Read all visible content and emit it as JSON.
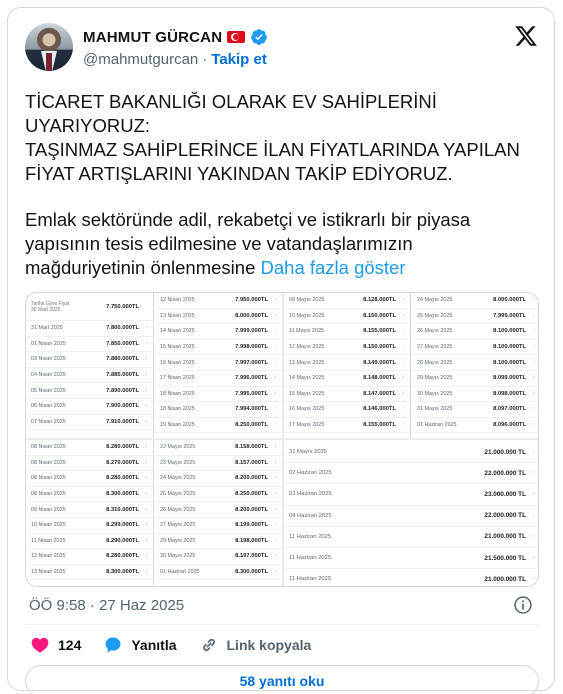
{
  "author": {
    "display_name": "MAHMUT GÜRCAN",
    "handle": "@mahmutgurcan",
    "separator": "·",
    "follow_label": "Takip et"
  },
  "tweet": {
    "paragraph1": "TİCARET BAKANLIĞI OLARAK EV SAHİPLERİNİ UYARIYORUZ:",
    "paragraph2": "TAŞINMAZ SAHİPLERİNCE İLAN FİYATLARINDA YAPILAN FİYAT ARTIŞLARINI YAKINDAN TAKİP EDİYORUZ.",
    "paragraph3": "Emlak sektöründe adil, rekabetçi ve istikrarlı bir piyasa yapısının tesis edilmesine ve vatandaşlarımızın mağduriyetinin önlenmesine",
    "show_more": "Daha fazla göster"
  },
  "media": {
    "top_left": {
      "header_label": "Tarihe Göre Fiyat",
      "header_date": "30 Mart 2025",
      "header_price": "7.750.000TL",
      "rows": [
        {
          "date": "31 Mart 2025",
          "price": "7.800.000TL"
        },
        {
          "date": "01 Nisan 2025",
          "price": "7.850.000TL"
        },
        {
          "date": "03 Nisan 2025",
          "price": "7.880.000TL"
        },
        {
          "date": "04 Nisan 2025",
          "price": "7.885.000TL"
        },
        {
          "date": "05 Nisan 2025",
          "price": "7.890.000TL"
        },
        {
          "date": "06 Nisan 2025",
          "price": "7.900.000TL"
        },
        {
          "date": "07 Nisan 2025",
          "price": "7.910.000TL"
        }
      ],
      "rows_b": [
        {
          "date": "12 Nisan 2025",
          "price": "7.950.000TL"
        },
        {
          "date": "13 Nisan 2025",
          "price": "8.000.000TL"
        },
        {
          "date": "14 Nisan 2025",
          "price": "7.999.000TL"
        },
        {
          "date": "15 Nisan 2025",
          "price": "7.998.000TL"
        },
        {
          "date": "16 Nisan 2025",
          "price": "7.997.000TL"
        },
        {
          "date": "17 Nisan 2025",
          "price": "7.996.000TL"
        },
        {
          "date": "18 Nisan 2025",
          "price": "7.995.000TL"
        },
        {
          "date": "18 Nisan 2025",
          "price": "7.994.000TL"
        },
        {
          "date": "19 Nisan 2025",
          "price": "8.250.000TL"
        }
      ]
    },
    "top_right": {
      "rows_a": [
        {
          "date": "09 Mayıs 2025",
          "price": "8.128.000TL"
        },
        {
          "date": "10 Mayıs 2025",
          "price": "8.150.000TL"
        },
        {
          "date": "11 Mayıs 2025",
          "price": "8.155.000TL"
        },
        {
          "date": "12 Mayıs 2025",
          "price": "8.150.000TL"
        },
        {
          "date": "13 Mayıs 2025",
          "price": "8.149.000TL"
        },
        {
          "date": "14 Mayıs 2025",
          "price": "8.148.000TL"
        },
        {
          "date": "15 Mayıs 2025",
          "price": "8.147.000TL"
        },
        {
          "date": "16 Mayıs 2025",
          "price": "8.146.000TL"
        },
        {
          "date": "17 Mayıs 2025",
          "price": "8.155.000TL"
        }
      ],
      "rows_b": [
        {
          "date": "24 Mayıs 2025",
          "price": "8.000.000TL"
        },
        {
          "date": "25 Mayıs 2025",
          "price": "7.999.000TL"
        },
        {
          "date": "26 Mayıs 2025",
          "price": "8.100.000TL"
        },
        {
          "date": "27 Mayıs 2025",
          "price": "8.100.000TL"
        },
        {
          "date": "28 Mayıs 2025",
          "price": "8.100.000TL"
        },
        {
          "date": "29 Mayıs 2025",
          "price": "8.099.000TL"
        },
        {
          "date": "30 Mayıs 2025",
          "price": "8.098.000TL"
        },
        {
          "date": "31 Mayıs 2025",
          "price": "8.097.000TL"
        },
        {
          "date": "01 Haziran 2025",
          "price": "8.096.000TL"
        }
      ]
    },
    "bottom_left": {
      "rows_a": [
        {
          "date": "08 Nisan 2025",
          "price": "8.280.000TL"
        },
        {
          "date": "08 Nisan 2025",
          "price": "8.270.000TL"
        },
        {
          "date": "08 Nisan 2025",
          "price": "8.280.000TL"
        },
        {
          "date": "08 Nisan 2025",
          "price": "8.300.000TL"
        },
        {
          "date": "09 Nisan 2025",
          "price": "8.310.000TL"
        },
        {
          "date": "10 Nisan 2025",
          "price": "8.299.000TL"
        },
        {
          "date": "11 Nisan 2025",
          "price": "8.290.000TL"
        },
        {
          "date": "12 Nisan 2025",
          "price": "8.280.000TL"
        },
        {
          "date": "13 Nisan 2025",
          "price": "8.300.000TL"
        }
      ],
      "rows_b": [
        {
          "date": "22 Mayıs 2025",
          "price": "8.158.000TL"
        },
        {
          "date": "23 Mayıs 2025",
          "price": "8.157.000TL"
        },
        {
          "date": "24 Mayıs 2025",
          "price": "8.200.000TL"
        },
        {
          "date": "25 Mayıs 2025",
          "price": "8.250.000TL"
        },
        {
          "date": "26 Mayıs 2025",
          "price": "8.200.000TL"
        },
        {
          "date": "27 Mayıs 2025",
          "price": "8.199.000TL"
        },
        {
          "date": "29 Mayıs 2025",
          "price": "8.198.000TL"
        },
        {
          "date": "30 Mayıs 2025",
          "price": "8.197.000TL"
        },
        {
          "date": "01 Haziran 2025",
          "price": "8.300.000TL"
        }
      ]
    },
    "bottom_right": {
      "rows": [
        {
          "date": "31 Mayıs 2025",
          "price": "21.000.000 TL"
        },
        {
          "date": "02 Haziran 2025",
          "price": "22.000.000 TL"
        },
        {
          "date": "03 Haziran 2025",
          "price": "23.000.000 TL"
        },
        {
          "date": "04 Haziran 2025",
          "price": "22.000.000 TL"
        },
        {
          "date": "11 Haziran 2025",
          "price": "21.000.000 TL"
        },
        {
          "date": "11 Haziran 2025",
          "price": "21.500.000 TL"
        },
        {
          "date": "11 Haziran 2025",
          "price": "21.000.000 TL"
        }
      ]
    }
  },
  "timestamp": "ÖÖ 9:58 · 27 Haz 2025",
  "actions": {
    "likes": "124",
    "reply_label": "Yanıtla",
    "copy_link_label": "Link kopyala"
  },
  "read_replies": "58 yanıtı oku",
  "colors": {
    "accent": "#1d9bf0",
    "like": "#f91880",
    "text_secondary": "#536471"
  },
  "icons": [
    "verified-badge-icon",
    "turkey-flag-icon",
    "x-logo-icon",
    "info-icon",
    "heart-icon",
    "reply-icon",
    "link-icon"
  ]
}
